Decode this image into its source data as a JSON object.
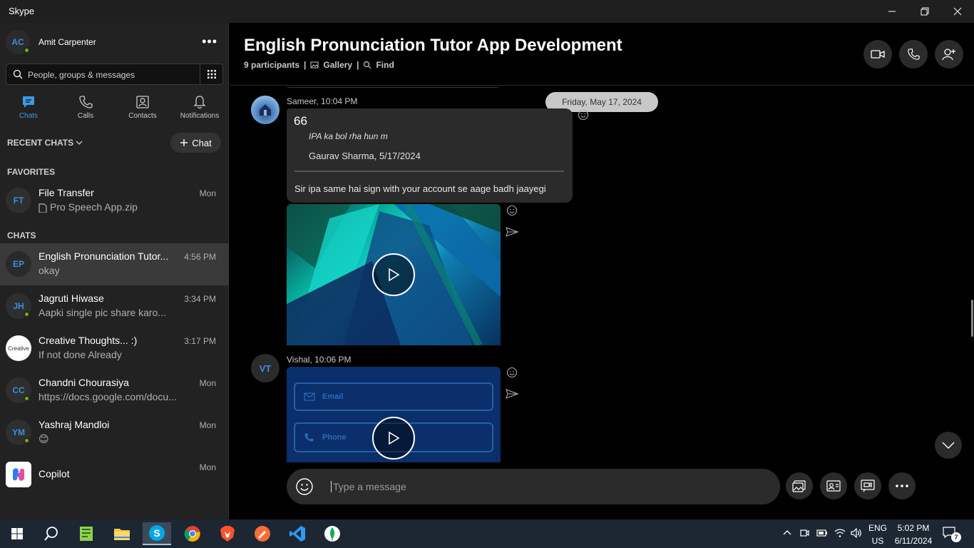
{
  "window": {
    "title": "Skype"
  },
  "profile": {
    "initials": "AC",
    "name": "Amit Carpenter",
    "more": "•••"
  },
  "search": {
    "placeholder": "People, groups & messages"
  },
  "nav": {
    "chats": "Chats",
    "calls": "Calls",
    "contacts": "Contacts",
    "notifications": "Notifications"
  },
  "recent": {
    "label": "RECENT CHATS",
    "new_chat": "Chat"
  },
  "favorites": {
    "label": "FAVORITES",
    "items": [
      {
        "initials": "FT",
        "name": "File Transfer",
        "preview": "Pro Speech App.zip",
        "time": "Mon"
      }
    ]
  },
  "chats": {
    "label": "CHATS",
    "items": [
      {
        "initials": "EP",
        "name": "English Pronunciation Tutor...",
        "preview": "okay",
        "time": "4:56 PM"
      },
      {
        "initials": "JH",
        "name": "Jagruti Hiwase",
        "preview": "Aapki single pic share karo...",
        "time": "3:34 PM"
      },
      {
        "initials": "Creative",
        "name": "Creative Thoughts... :)",
        "preview": "If not done Already",
        "time": "3:17 PM"
      },
      {
        "initials": "CC",
        "name": "Chandni Chourasiya",
        "preview": "https://docs.google.com/docu...",
        "time": "Mon"
      },
      {
        "initials": "YM",
        "name": "Yashraj Mandloi",
        "preview": "😊",
        "time": "Mon"
      },
      {
        "initials": "",
        "name": "Copilot",
        "preview": "",
        "time": "Mon"
      }
    ]
  },
  "conversation": {
    "title": "English Pronunciation Tutor App Development",
    "participants": "9 participants",
    "gallery": "Gallery",
    "find": "Find",
    "date": "Friday, May 17, 2024"
  },
  "messages": {
    "m1": {
      "sender": "Sameer, 10:04 PM",
      "quote_mark": "66",
      "quote_text": "IPA ka bol rha hun m",
      "quote_author": "Gaurav Sharma, 5/17/2024",
      "body": "Sir ipa  same hai sign with your account se aage badh jaayegi"
    },
    "m2": {
      "initials": "VT",
      "sender": "Vishal, 10:06 PM",
      "video_field_1": "Email",
      "video_field_2": "Phone"
    }
  },
  "composer": {
    "placeholder": "Type a message"
  },
  "taskbar": {
    "lang1": "ENG",
    "lang2": "US",
    "time": "5:02 PM",
    "date": "6/11/2024",
    "notif_count": "7"
  },
  "colors": {
    "accent": "#3b9ae8",
    "presence": "#6bb700",
    "sidebar": "#222222",
    "bubble": "#2b2b2b"
  }
}
